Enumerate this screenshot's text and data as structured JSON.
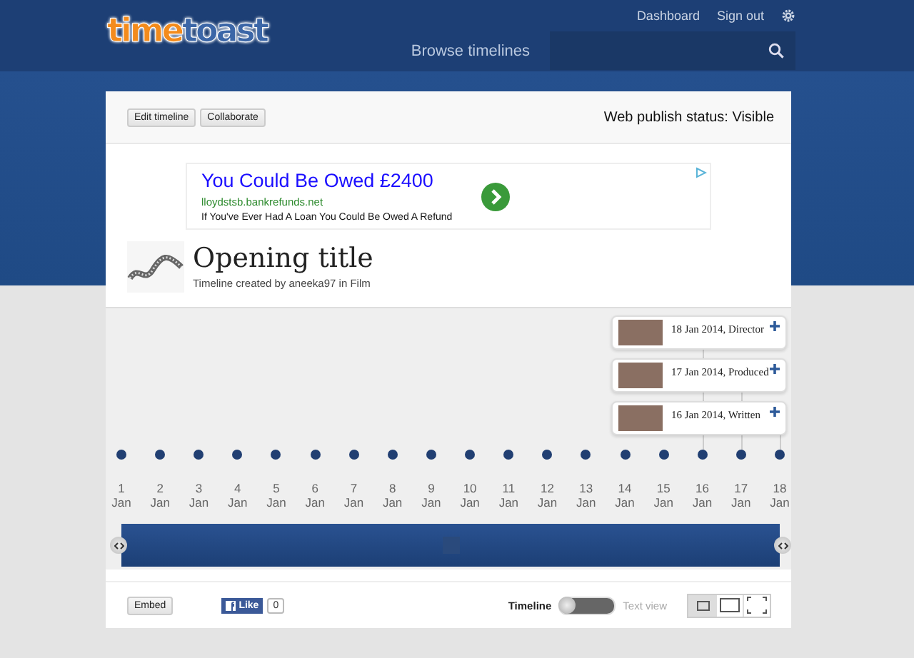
{
  "header": {
    "logo": {
      "part_1": "time",
      "part_2": "toast"
    },
    "links": [
      "Dashboard",
      "Sign out"
    ],
    "browse": "Browse timelines"
  },
  "toolbar": {
    "buttons": [
      "Edit timeline",
      "Collaborate"
    ],
    "publish_status": "Web publish status: Visible"
  },
  "ad": {
    "headline": "You Could Be Owed £2400",
    "url": "lloydstsb.bankrefunds.net",
    "description": "If You've Ever Had A Loan You Could Be Owed A Refund"
  },
  "timeline": {
    "title": "Opening title",
    "subtitle": "Timeline created by aneeka97 in Film"
  },
  "events": [
    {
      "text": "18 Jan 2014, Director"
    },
    {
      "text": "17 Jan 2014, Produced"
    },
    {
      "text": "16 Jan 2014, Written"
    }
  ],
  "dates": [
    {
      "day": "1",
      "month": "Jan"
    },
    {
      "day": "2",
      "month": "Jan"
    },
    {
      "day": "3",
      "month": "Jan"
    },
    {
      "day": "4",
      "month": "Jan"
    },
    {
      "day": "5",
      "month": "Jan"
    },
    {
      "day": "6",
      "month": "Jan"
    },
    {
      "day": "7",
      "month": "Jan"
    },
    {
      "day": "8",
      "month": "Jan"
    },
    {
      "day": "9",
      "month": "Jan"
    },
    {
      "day": "10",
      "month": "Jan"
    },
    {
      "day": "11",
      "month": "Jan"
    },
    {
      "day": "12",
      "month": "Jan"
    },
    {
      "day": "13",
      "month": "Jan"
    },
    {
      "day": "14",
      "month": "Jan"
    },
    {
      "day": "15",
      "month": "Jan"
    },
    {
      "day": "16",
      "month": "Jan"
    },
    {
      "day": "17",
      "month": "Jan"
    },
    {
      "day": "18",
      "month": "Jan"
    }
  ],
  "footer": {
    "embed": "Embed",
    "like": "Like",
    "like_count": "0",
    "view_label": "Timeline",
    "alt_view_label": "Text view",
    "text_view": false,
    "layouts": [
      {
        "kind": "small",
        "selected": true
      },
      {
        "kind": "wide",
        "selected": false
      },
      {
        "kind": "fullscreen",
        "selected": false
      }
    ]
  }
}
